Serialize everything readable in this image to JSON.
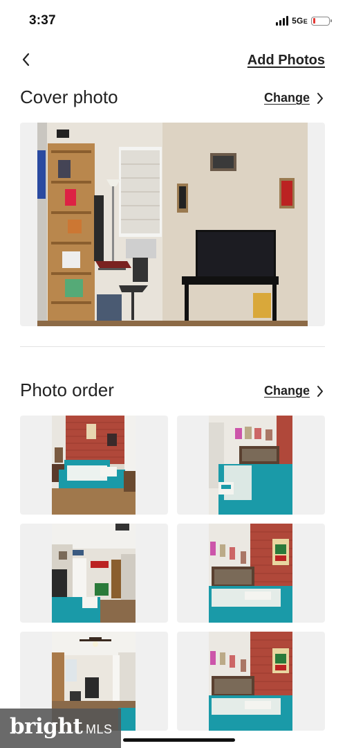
{
  "status_bar": {
    "time": "3:37",
    "network": "5G",
    "network_suffix": "E",
    "signal_bars": 4,
    "battery_level": 0.12,
    "battery_color": "#e53935"
  },
  "nav": {
    "back_icon": "chevron-left-icon",
    "add_photos_label": "Add Photos"
  },
  "cover": {
    "title": "Cover photo",
    "change_label": "Change",
    "change_icon": "chevron-right-icon"
  },
  "photo_order": {
    "title": "Photo order",
    "change_label": "Change",
    "change_icon": "chevron-right-icon",
    "photos": [
      "bedroom-brick-wall",
      "bedroom-bed-close",
      "bedroom-doorway",
      "bedroom-ninja-poster",
      "living-room-fan",
      "bedroom-ninja-poster-2"
    ]
  },
  "watermark": {
    "brand": "bright",
    "suffix": "MLS"
  },
  "colors": {
    "text": "#222222",
    "tile_bg": "#f0f0f0",
    "bedding": "#1a9aa8",
    "brick": "#b0483a"
  }
}
